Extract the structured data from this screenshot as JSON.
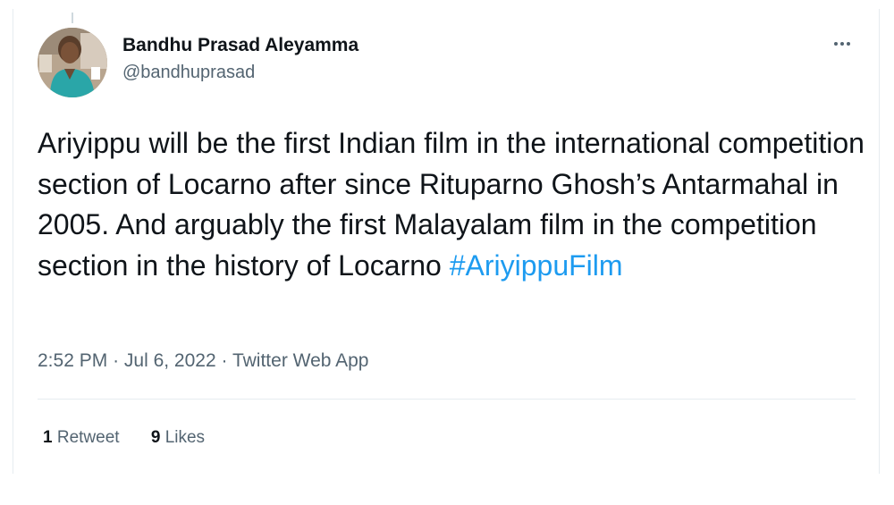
{
  "author": {
    "name": "Bandhu Prasad Aleyamma",
    "handle": "@bandhuprasad"
  },
  "tweet": {
    "text": "Ariyippu will be the first Indian film in the international competition section of Locarno after since Rituparno Ghosh’s Antarmahal in 2005. And arguably the first Malayalam film in the competition section in the history of Locarno ",
    "hashtag": "#AriyippuFilm"
  },
  "meta": {
    "time": "2:52 PM",
    "separator": "·",
    "date": "Jul 6, 2022",
    "source": "Twitter Web App"
  },
  "stats": {
    "retweets_count": "1",
    "retweets_label": "Retweet",
    "likes_count": "9",
    "likes_label": "Likes"
  },
  "icons": {
    "more": "more-horizontal-icon"
  },
  "colors": {
    "link": "#1d9bf0",
    "secondary_text": "#536471",
    "primary_text": "#0f1419"
  }
}
